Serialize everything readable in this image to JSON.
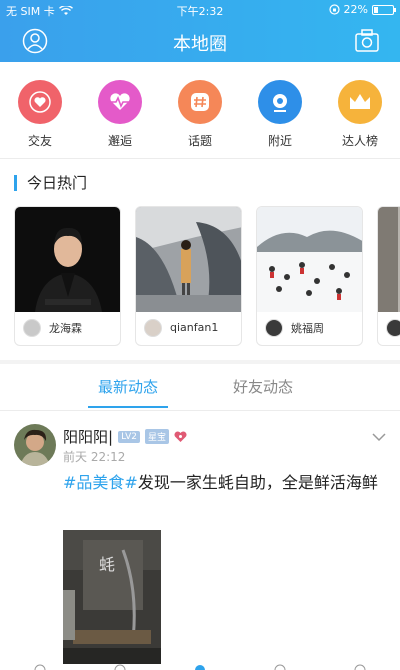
{
  "status": {
    "carrier": "无 SIM 卡",
    "time": "下午2:32",
    "battery": "22%",
    "battery_level": 0.22
  },
  "header": {
    "title": "本地圈"
  },
  "quick": [
    {
      "label": "交友",
      "icon": "heart-icon",
      "color": "#f0636a"
    },
    {
      "label": "邂逅",
      "icon": "heartbeat-icon",
      "color": "#e45ac9"
    },
    {
      "label": "话题",
      "icon": "hashtag-icon",
      "color": "#f58758"
    },
    {
      "label": "附近",
      "icon": "location-icon",
      "color": "#2e8fe8"
    },
    {
      "label": "达人榜",
      "icon": "crown-icon",
      "color": "#f6b33b"
    }
  ],
  "hot": {
    "title": "今日热门",
    "items": [
      {
        "user": "龙海霖"
      },
      {
        "user": "qianfan1"
      },
      {
        "user": "姚福周"
      },
      {
        "user": ""
      }
    ]
  },
  "tabs": [
    {
      "label": "最新动态"
    },
    {
      "label": "好友动态"
    }
  ],
  "post": {
    "name": "阳阳阳|",
    "level": "LV2",
    "vip": "星宝",
    "time": "前天 22:12",
    "hashtag": "#品美食#",
    "text": "发现一家生蚝自助，全是鲜活海鲜"
  }
}
